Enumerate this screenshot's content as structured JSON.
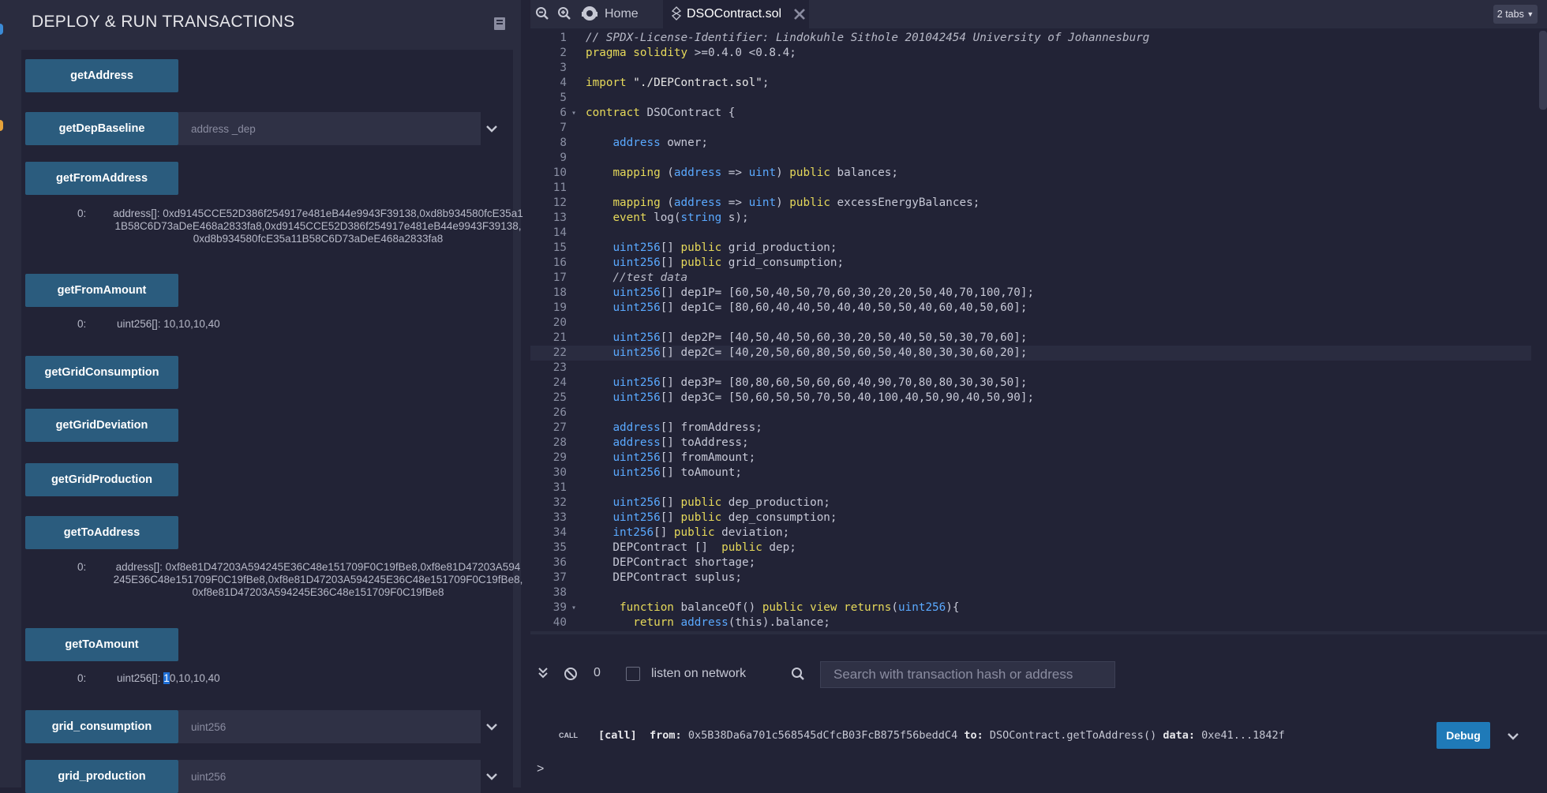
{
  "left_panel": {
    "title": "DEPLOY & RUN TRANSACTIONS",
    "functions": [
      {
        "label": "getAddress"
      },
      {
        "label": "getDepBaseline",
        "placeholder": "address _dep"
      },
      {
        "label": "getFromAddress",
        "result_index": "0:",
        "result": "address[]: 0xd9145CCE52D386f254917e481eB44e9943F39138,0xd8b934580fcE35a11B58C6D73aDeE468a2833fa8,0xd9145CCE52D386f254917e481eB44e9943F39138,0xd8b934580fcE35a11B58C6D73aDeE468a2833fa8"
      },
      {
        "label": "getFromAmount",
        "result_index": "0:",
        "result": "uint256[]: 10,10,10,40"
      },
      {
        "label": "getGridConsumption"
      },
      {
        "label": "getGridDeviation"
      },
      {
        "label": "getGridProduction"
      },
      {
        "label": "getToAddress",
        "result_index": "0:",
        "result": "address[]: 0xf8e81D47203A594245E36C48e151709F0C19fBe8,0xf8e81D47203A594245E36C48e151709F0C19fBe8,0xf8e81D47203A594245E36C48e151709F0C19fBe8,0xf8e81D47203A594245E36C48e151709F0C19fBe8"
      },
      {
        "label": "getToAmount",
        "result_index": "0:",
        "result_prefix": "uint256[]: ",
        "result_selected": "1",
        "result_rest": "0,10,10,40"
      },
      {
        "label": "grid_consumption",
        "placeholder": "uint256"
      },
      {
        "label": "grid_production",
        "placeholder": "uint256"
      }
    ]
  },
  "editor": {
    "tabs": {
      "home": "Home",
      "active": "DSOContract.sol",
      "count": "2 tabs"
    },
    "lines": [
      {
        "n": "1",
        "code": "// SPDX-License-Identifier: Lindokuhle Sithole 201042454 University of Johannesburg"
      },
      {
        "n": "2",
        "code": "pragma solidity >=0.4.0 <0.8.4;"
      },
      {
        "n": "3",
        "code": ""
      },
      {
        "n": "4",
        "code": "import \"./DEPContract.sol\";"
      },
      {
        "n": "5",
        "code": ""
      },
      {
        "n": "6",
        "code": "contract DSOContract {"
      },
      {
        "n": "7",
        "code": ""
      },
      {
        "n": "8",
        "code": "    address owner;"
      },
      {
        "n": "9",
        "code": ""
      },
      {
        "n": "10",
        "code": "    mapping (address => uint) public balances;"
      },
      {
        "n": "11",
        "code": ""
      },
      {
        "n": "12",
        "code": "    mapping (address => uint) public excessEnergyBalances;"
      },
      {
        "n": "13",
        "code": "    event log(string s);"
      },
      {
        "n": "14",
        "code": ""
      },
      {
        "n": "15",
        "code": "    uint256[] public grid_production;"
      },
      {
        "n": "16",
        "code": "    uint256[] public grid_consumption;"
      },
      {
        "n": "17",
        "code": "    //test data"
      },
      {
        "n": "18",
        "code": "    uint256[] dep1P= [60,50,40,50,70,60,30,20,20,50,40,70,100,70];"
      },
      {
        "n": "19",
        "code": "    uint256[] dep1C= [80,60,40,40,50,40,40,50,50,40,60,40,50,60];"
      },
      {
        "n": "20",
        "code": ""
      },
      {
        "n": "21",
        "code": "    uint256[] dep2P= [40,50,40,50,60,30,20,50,40,50,50,30,70,60];"
      },
      {
        "n": "22",
        "code": "    uint256[] dep2C= [40,20,50,60,80,50,60,50,40,80,30,30,60,20];"
      },
      {
        "n": "23",
        "code": ""
      },
      {
        "n": "24",
        "code": "    uint256[] dep3P= [80,80,60,50,60,60,40,90,70,80,80,30,30,50];"
      },
      {
        "n": "25",
        "code": "    uint256[] dep3C= [50,60,50,50,70,50,40,100,40,50,90,40,50,90];"
      },
      {
        "n": "26",
        "code": ""
      },
      {
        "n": "27",
        "code": "    address[] fromAddress;"
      },
      {
        "n": "28",
        "code": "    address[] toAddress;"
      },
      {
        "n": "29",
        "code": "    uint256[] fromAmount;"
      },
      {
        "n": "30",
        "code": "    uint256[] toAmount;"
      },
      {
        "n": "31",
        "code": ""
      },
      {
        "n": "32",
        "code": "    uint256[] public dep_production;"
      },
      {
        "n": "33",
        "code": "    uint256[] public dep_consumption;"
      },
      {
        "n": "34",
        "code": "    int256[] public deviation;"
      },
      {
        "n": "35",
        "code": "    DEPContract []  public dep;"
      },
      {
        "n": "36",
        "code": "    DEPContract shortage;"
      },
      {
        "n": "37",
        "code": "    DEPContract suplus;"
      },
      {
        "n": "38",
        "code": ""
      },
      {
        "n": "39",
        "code": "     function balanceOf() public view returns(uint256){"
      },
      {
        "n": "40",
        "code": "       return address(this).balance;"
      }
    ]
  },
  "terminal": {
    "count": "0",
    "listen_label": "listen on network",
    "search_placeholder": "Search with transaction hash or address",
    "log": {
      "label": "CALL",
      "call": "[call]",
      "from_label": "from:",
      "from": "0x5B38Da6a701c568545dCfcB03FcB875f56beddC4",
      "to_label": "to:",
      "to": "DSOContract.getToAddress()",
      "data_label": "data:",
      "data": "0xe41...1842f"
    },
    "debug_label": "Debug",
    "prompt": ">"
  },
  "colors": {
    "background": "#222336",
    "panel": "#2a2c3f",
    "button": "#2b5c7e",
    "keyword": "#e6d95a",
    "type": "#5aa9ff",
    "debug": "#1f7ab8"
  }
}
